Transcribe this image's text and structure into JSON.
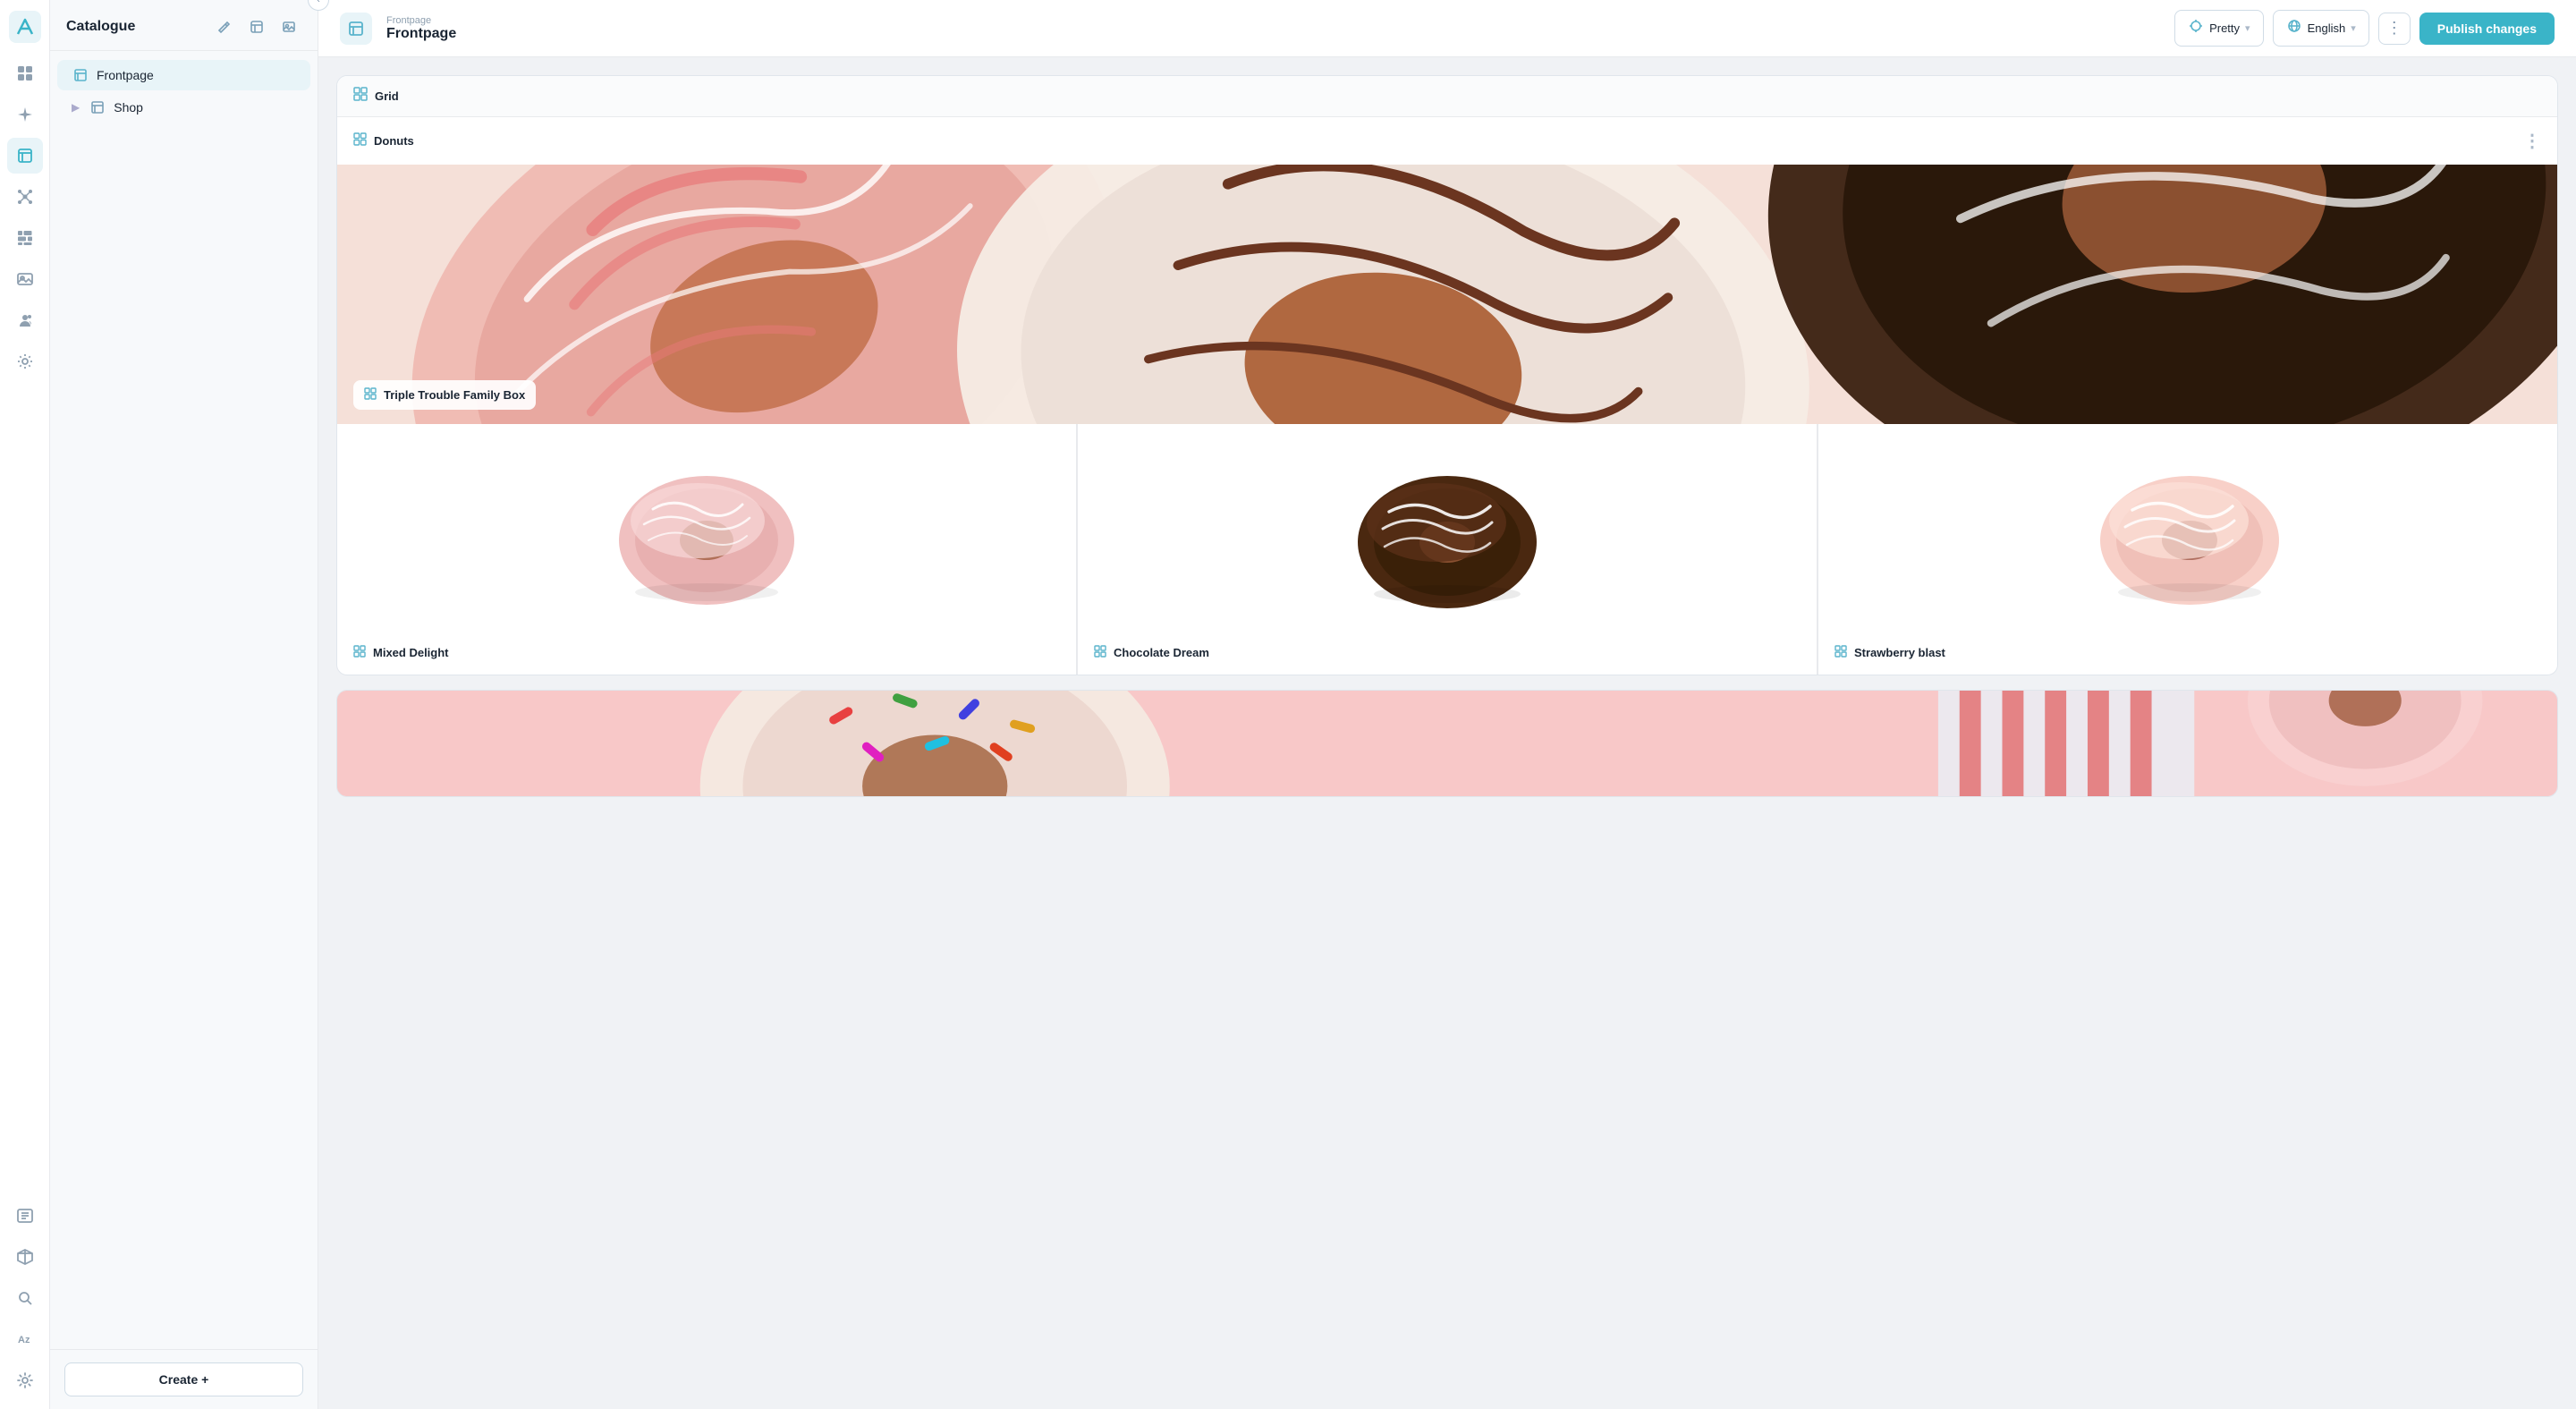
{
  "app": {
    "logo_label": "App Logo"
  },
  "sidebar": {
    "title": "Catalogue",
    "header_actions": [
      "edit-icon",
      "book-icon",
      "image-icon"
    ],
    "items": [
      {
        "id": "frontpage",
        "label": "Frontpage",
        "icon": "page-icon",
        "active": true
      },
      {
        "id": "shop",
        "label": "Shop",
        "icon": "folder-icon",
        "active": false,
        "has_children": true
      }
    ],
    "create_button": "Create +"
  },
  "nav_icons": [
    {
      "id": "grid-icon",
      "active": false
    },
    {
      "id": "sparkle-icon",
      "active": false
    },
    {
      "id": "book-icon",
      "active": true
    },
    {
      "id": "nodes-icon",
      "active": false
    },
    {
      "id": "grid2-icon",
      "active": false
    },
    {
      "id": "image-icon",
      "active": false
    },
    {
      "id": "people-icon",
      "active": false
    },
    {
      "id": "settings2-icon",
      "active": false
    },
    {
      "id": "list-icon",
      "active": false
    },
    {
      "id": "box-icon",
      "active": false
    },
    {
      "id": "search-icon",
      "active": false
    },
    {
      "id": "az-icon",
      "active": false
    },
    {
      "id": "gear-icon",
      "active": false
    }
  ],
  "topbar": {
    "breadcrumb_parent": "Frontpage",
    "breadcrumb_current": "Frontpage",
    "pretty_button": "Pretty",
    "language_button": "English",
    "publish_button": "Publish changes"
  },
  "content": {
    "grid_label": "Grid",
    "donuts_label": "Donuts",
    "products": {
      "hero": {
        "label": "Triple Trouble Family Box",
        "icon": "product-icon"
      },
      "row": [
        {
          "id": "mixed-delight",
          "label": "Mixed Delight",
          "icon": "product-icon",
          "donut_color": "pink"
        },
        {
          "id": "chocolate-dream",
          "label": "Chocolate Dream",
          "icon": "product-icon",
          "donut_color": "chocolate"
        },
        {
          "id": "strawberry-blast",
          "label": "Strawberry blast",
          "icon": "product-icon",
          "donut_color": "pink-light"
        }
      ]
    }
  }
}
